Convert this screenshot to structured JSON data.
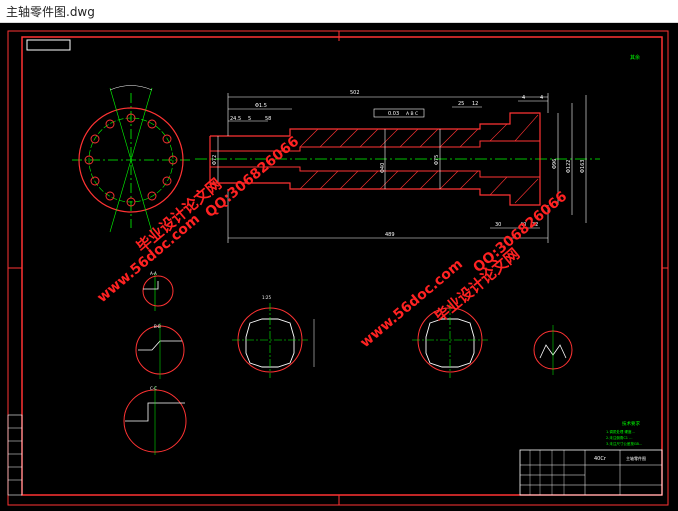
{
  "window": {
    "title": "主轴零件图.dwg"
  },
  "colors": {
    "background": "#000000",
    "frame": "#ff0000",
    "part": "#ff3333",
    "centerline": "#00ff00",
    "text": "#ffffff",
    "note": "#00ff00"
  },
  "dimensions": {
    "overall_top": "502",
    "overall_bottom": "489",
    "d1": "Φ1.5",
    "d2": "58",
    "d3": "24.5",
    "d4": "5",
    "d5": "25",
    "d6": "12",
    "d7": "4",
    "d8": "4",
    "d9": "10",
    "d10": "30",
    "d11": "40",
    "d12": "32",
    "tol": "0.03",
    "tol_ref": "A B C",
    "dia_a": "Φ72",
    "dia_b": "Φ40",
    "dia_c": "Φ80",
    "dia_d": "Φ75",
    "dia_e": "Φ96",
    "dia_f": "Φ122",
    "dia_g": "Φ163",
    "section_label": "1:25"
  },
  "notes": {
    "corner_tag": "其余",
    "tech_title": "技术要求",
    "tech_line1": "1.调质处理  硬度...",
    "tech_line2": "2.未注倒角C1  ...",
    "tech_line3": "3.未注尺寸公差按GB..."
  },
  "title_block": {
    "material": "40Cr",
    "drawing_name": "主轴零件图"
  },
  "watermarks": {
    "site": "www.56doc.com",
    "brand": "毕业设计论文网",
    "qq": "QQ:306826066"
  }
}
